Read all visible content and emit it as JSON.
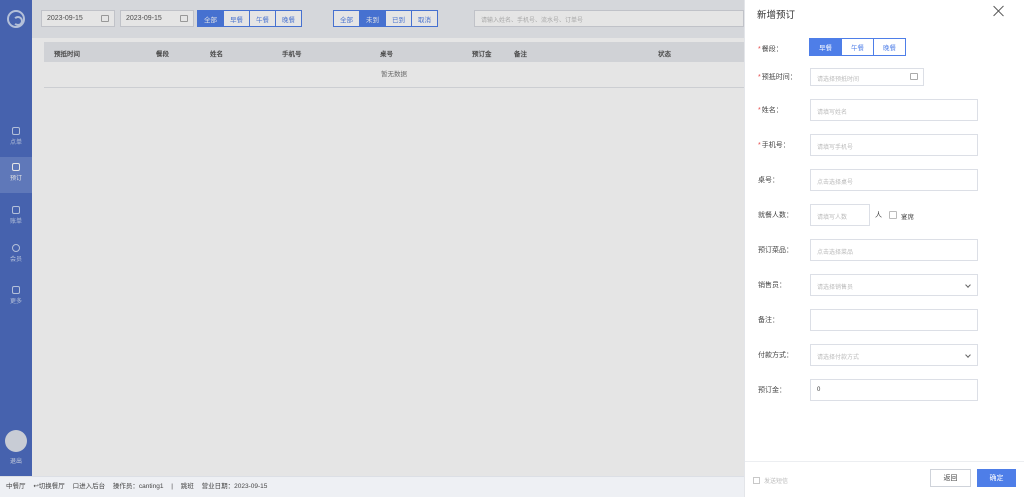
{
  "sidebar": {
    "items": [
      {
        "label": "点单",
        "icon": "cup-icon"
      },
      {
        "label": "预订",
        "icon": "book-icon"
      },
      {
        "label": "账单",
        "icon": "chart-icon"
      },
      {
        "label": "会员",
        "icon": "heart-icon"
      },
      {
        "label": "更多",
        "icon": "grid-icon"
      }
    ],
    "exit_label": "退出"
  },
  "filter": {
    "start_date": "2023-09-15",
    "end_date": "2023-09-15",
    "separator": "-",
    "meal_options": [
      "全部",
      "早餐",
      "午餐",
      "晚餐"
    ],
    "meal_selected": "全部",
    "status_options": [
      "全部",
      "未到",
      "已到",
      "取消"
    ],
    "status_selected": "未到",
    "search_placeholder": "请输入姓名、手机号、流水号、订单号"
  },
  "table": {
    "columns": [
      "预抵时间",
      "餐段",
      "姓名",
      "手机号",
      "桌号",
      "预订金",
      "备注",
      "状态"
    ],
    "empty_text": "暂无数据"
  },
  "statusbar": {
    "items": [
      "中餐厅",
      "↩切换餐厅",
      "口进入后台",
      "操作员：canting1",
      "|",
      "跳班",
      "营业日期：2023-09-15"
    ]
  },
  "drawer": {
    "title": "新增预订",
    "meal": {
      "label": "餐段：",
      "options": [
        "早餐",
        "午餐",
        "晚餐"
      ],
      "selected": "早餐"
    },
    "arrival": {
      "label": "预抵时间：",
      "placeholder": "请选择预抵时间"
    },
    "name": {
      "label": "姓名：",
      "placeholder": "请填写姓名"
    },
    "phone": {
      "label": "手机号：",
      "placeholder": "请填写手机号"
    },
    "table_no": {
      "label": "桌号：",
      "placeholder": "点击选择桌号"
    },
    "guests": {
      "label": "就餐人数：",
      "placeholder": "请填写人数",
      "unit": "人",
      "checkbox_label": "宴席"
    },
    "dishes": {
      "label": "预订菜品：",
      "placeholder": "点击选择菜品"
    },
    "salesperson": {
      "label": "销售员：",
      "placeholder": "请选择销售员"
    },
    "remark": {
      "label": "备注：",
      "placeholder": ""
    },
    "payment": {
      "label": "付款方式：",
      "placeholder": "请选择付款方式"
    },
    "deposit": {
      "label": "预订金：",
      "value": "0"
    },
    "footer": {
      "checkbox_label": "发送短信",
      "back_label": "返回",
      "ok_label": "确定"
    }
  },
  "colors": {
    "primary": "#4e7ee8",
    "sidebar": "#4e6ec2",
    "required": "#e54b4b"
  }
}
